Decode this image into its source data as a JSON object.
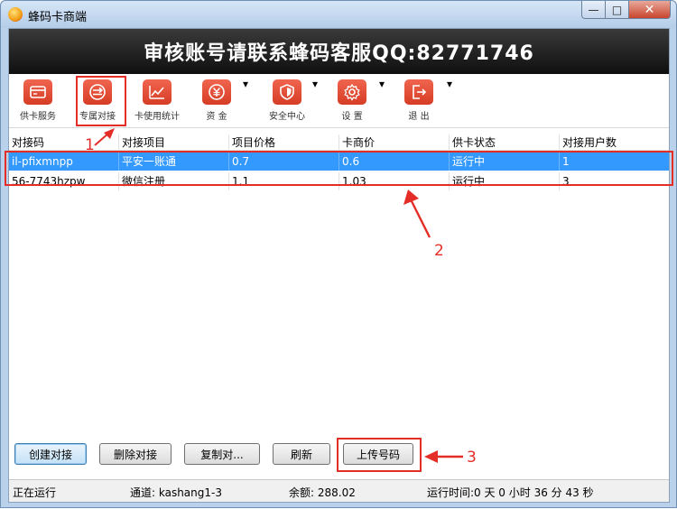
{
  "window": {
    "title": "蜂码卡商端",
    "minimize": "—",
    "maximize": "□",
    "close": "✕"
  },
  "banner": {
    "text": "审核账号请联系蜂码客服QQ:82771746"
  },
  "toolbar": {
    "items": [
      {
        "label": "供卡服务",
        "icon": "card-icon"
      },
      {
        "label": "专属对接",
        "icon": "exchange-icon"
      },
      {
        "label": "卡使用统计",
        "icon": "chart-icon"
      },
      {
        "label": "资 金",
        "icon": "yuan-icon"
      },
      {
        "label": "安全中心",
        "icon": "shield-icon"
      },
      {
        "label": "设 置",
        "icon": "gear-icon"
      },
      {
        "label": "退 出",
        "icon": "exit-icon"
      }
    ],
    "dropdown": "▾"
  },
  "table": {
    "columns": [
      "对接码",
      "对接项目",
      "项目价格",
      "卡商价",
      "供卡状态",
      "对接用户数"
    ],
    "rows": [
      [
        "il-pfixmnpp",
        "平安一账通",
        "0.7",
        "0.6",
        "运行中",
        "1"
      ],
      [
        "56-7743hzpw",
        "微信注册",
        "1.1",
        "1.03",
        "运行中",
        "3"
      ]
    ]
  },
  "buttons": {
    "create": "创建对接",
    "delete": "删除对接",
    "copy": "复制对...",
    "refresh": "刷新",
    "upload": "上传号码"
  },
  "status": {
    "state": "正在运行",
    "channel": "通道:  kashang1-3",
    "balance": "余额:  288.02",
    "runtime": "运行时间:0 天 0 小时 36 分 43 秒"
  },
  "annotations": {
    "a1": "1",
    "a2": "2",
    "a3": "3"
  },
  "colors": {
    "accent_red": "#e52d27",
    "selection_blue": "#3399ff"
  }
}
